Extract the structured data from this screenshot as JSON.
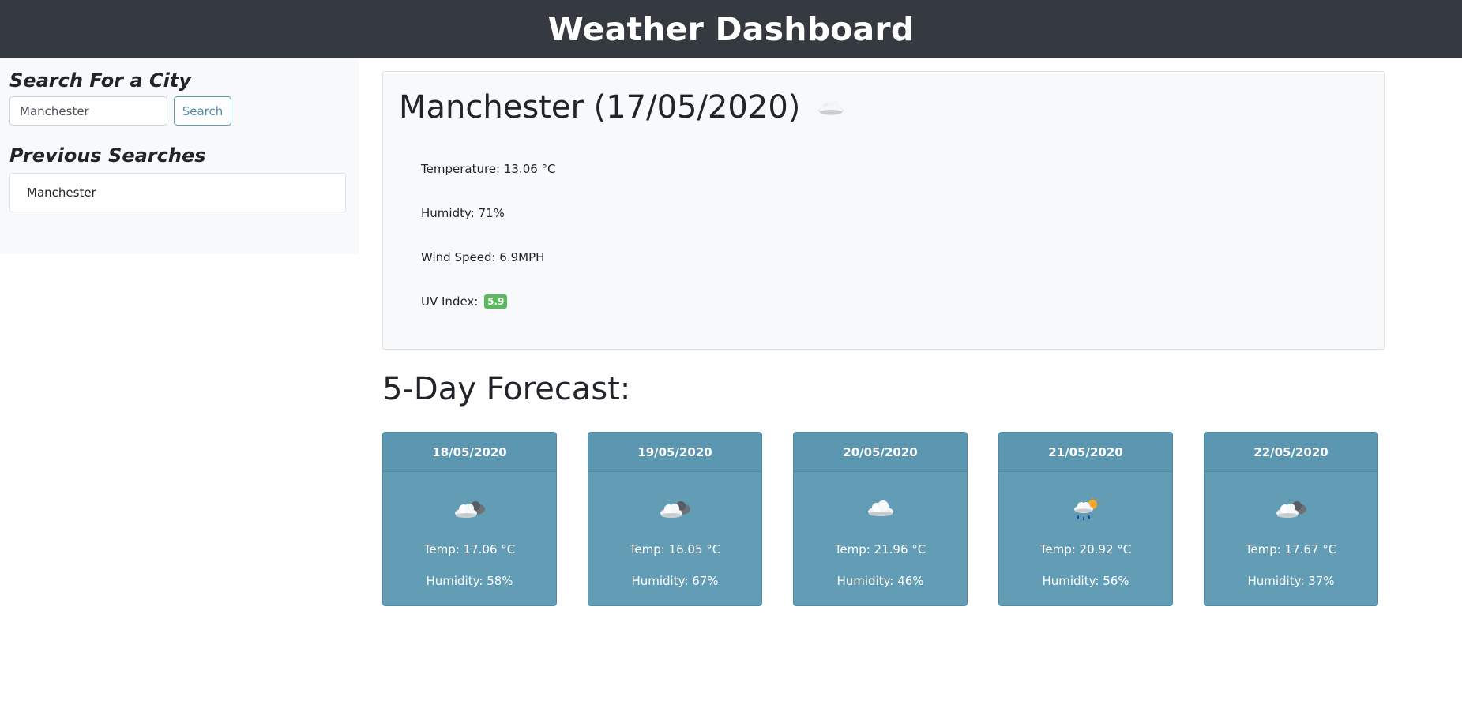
{
  "header": {
    "title": "Weather Dashboard"
  },
  "sidebar": {
    "search_title": "Search For a City",
    "search_value": "Manchester",
    "search_button": "Search",
    "previous_title": "Previous Searches",
    "previous": [
      "Manchester"
    ]
  },
  "current": {
    "title": "Manchester (17/05/2020)",
    "icon": "clouds-icon",
    "temperature": "Temperature: 13.06 °C",
    "humidity": "Humidty: 71%",
    "wind": "Wind Speed: 6.9MPH",
    "uv_label": "UV Index:",
    "uv_value": "5.9",
    "uv_color": "#5cb85c"
  },
  "forecast": {
    "title": "5-Day Forecast:",
    "days": [
      {
        "date": "18/05/2020",
        "icon": "broken-clouds-icon",
        "temp": "Temp: 17.06 °C",
        "humidity": "Humidity: 58%"
      },
      {
        "date": "19/05/2020",
        "icon": "broken-clouds-icon",
        "temp": "Temp: 16.05 °C",
        "humidity": "Humidity: 67%"
      },
      {
        "date": "20/05/2020",
        "icon": "cloud-icon",
        "temp": "Temp: 21.96 °C",
        "humidity": "Humidity: 46%"
      },
      {
        "date": "21/05/2020",
        "icon": "rain-sun-icon",
        "temp": "Temp: 20.92 °C",
        "humidity": "Humidity: 56%"
      },
      {
        "date": "22/05/2020",
        "icon": "broken-clouds-icon",
        "temp": "Temp: 17.67 °C",
        "humidity": "Humidity: 37%"
      }
    ],
    "card_color": "#639db5"
  }
}
